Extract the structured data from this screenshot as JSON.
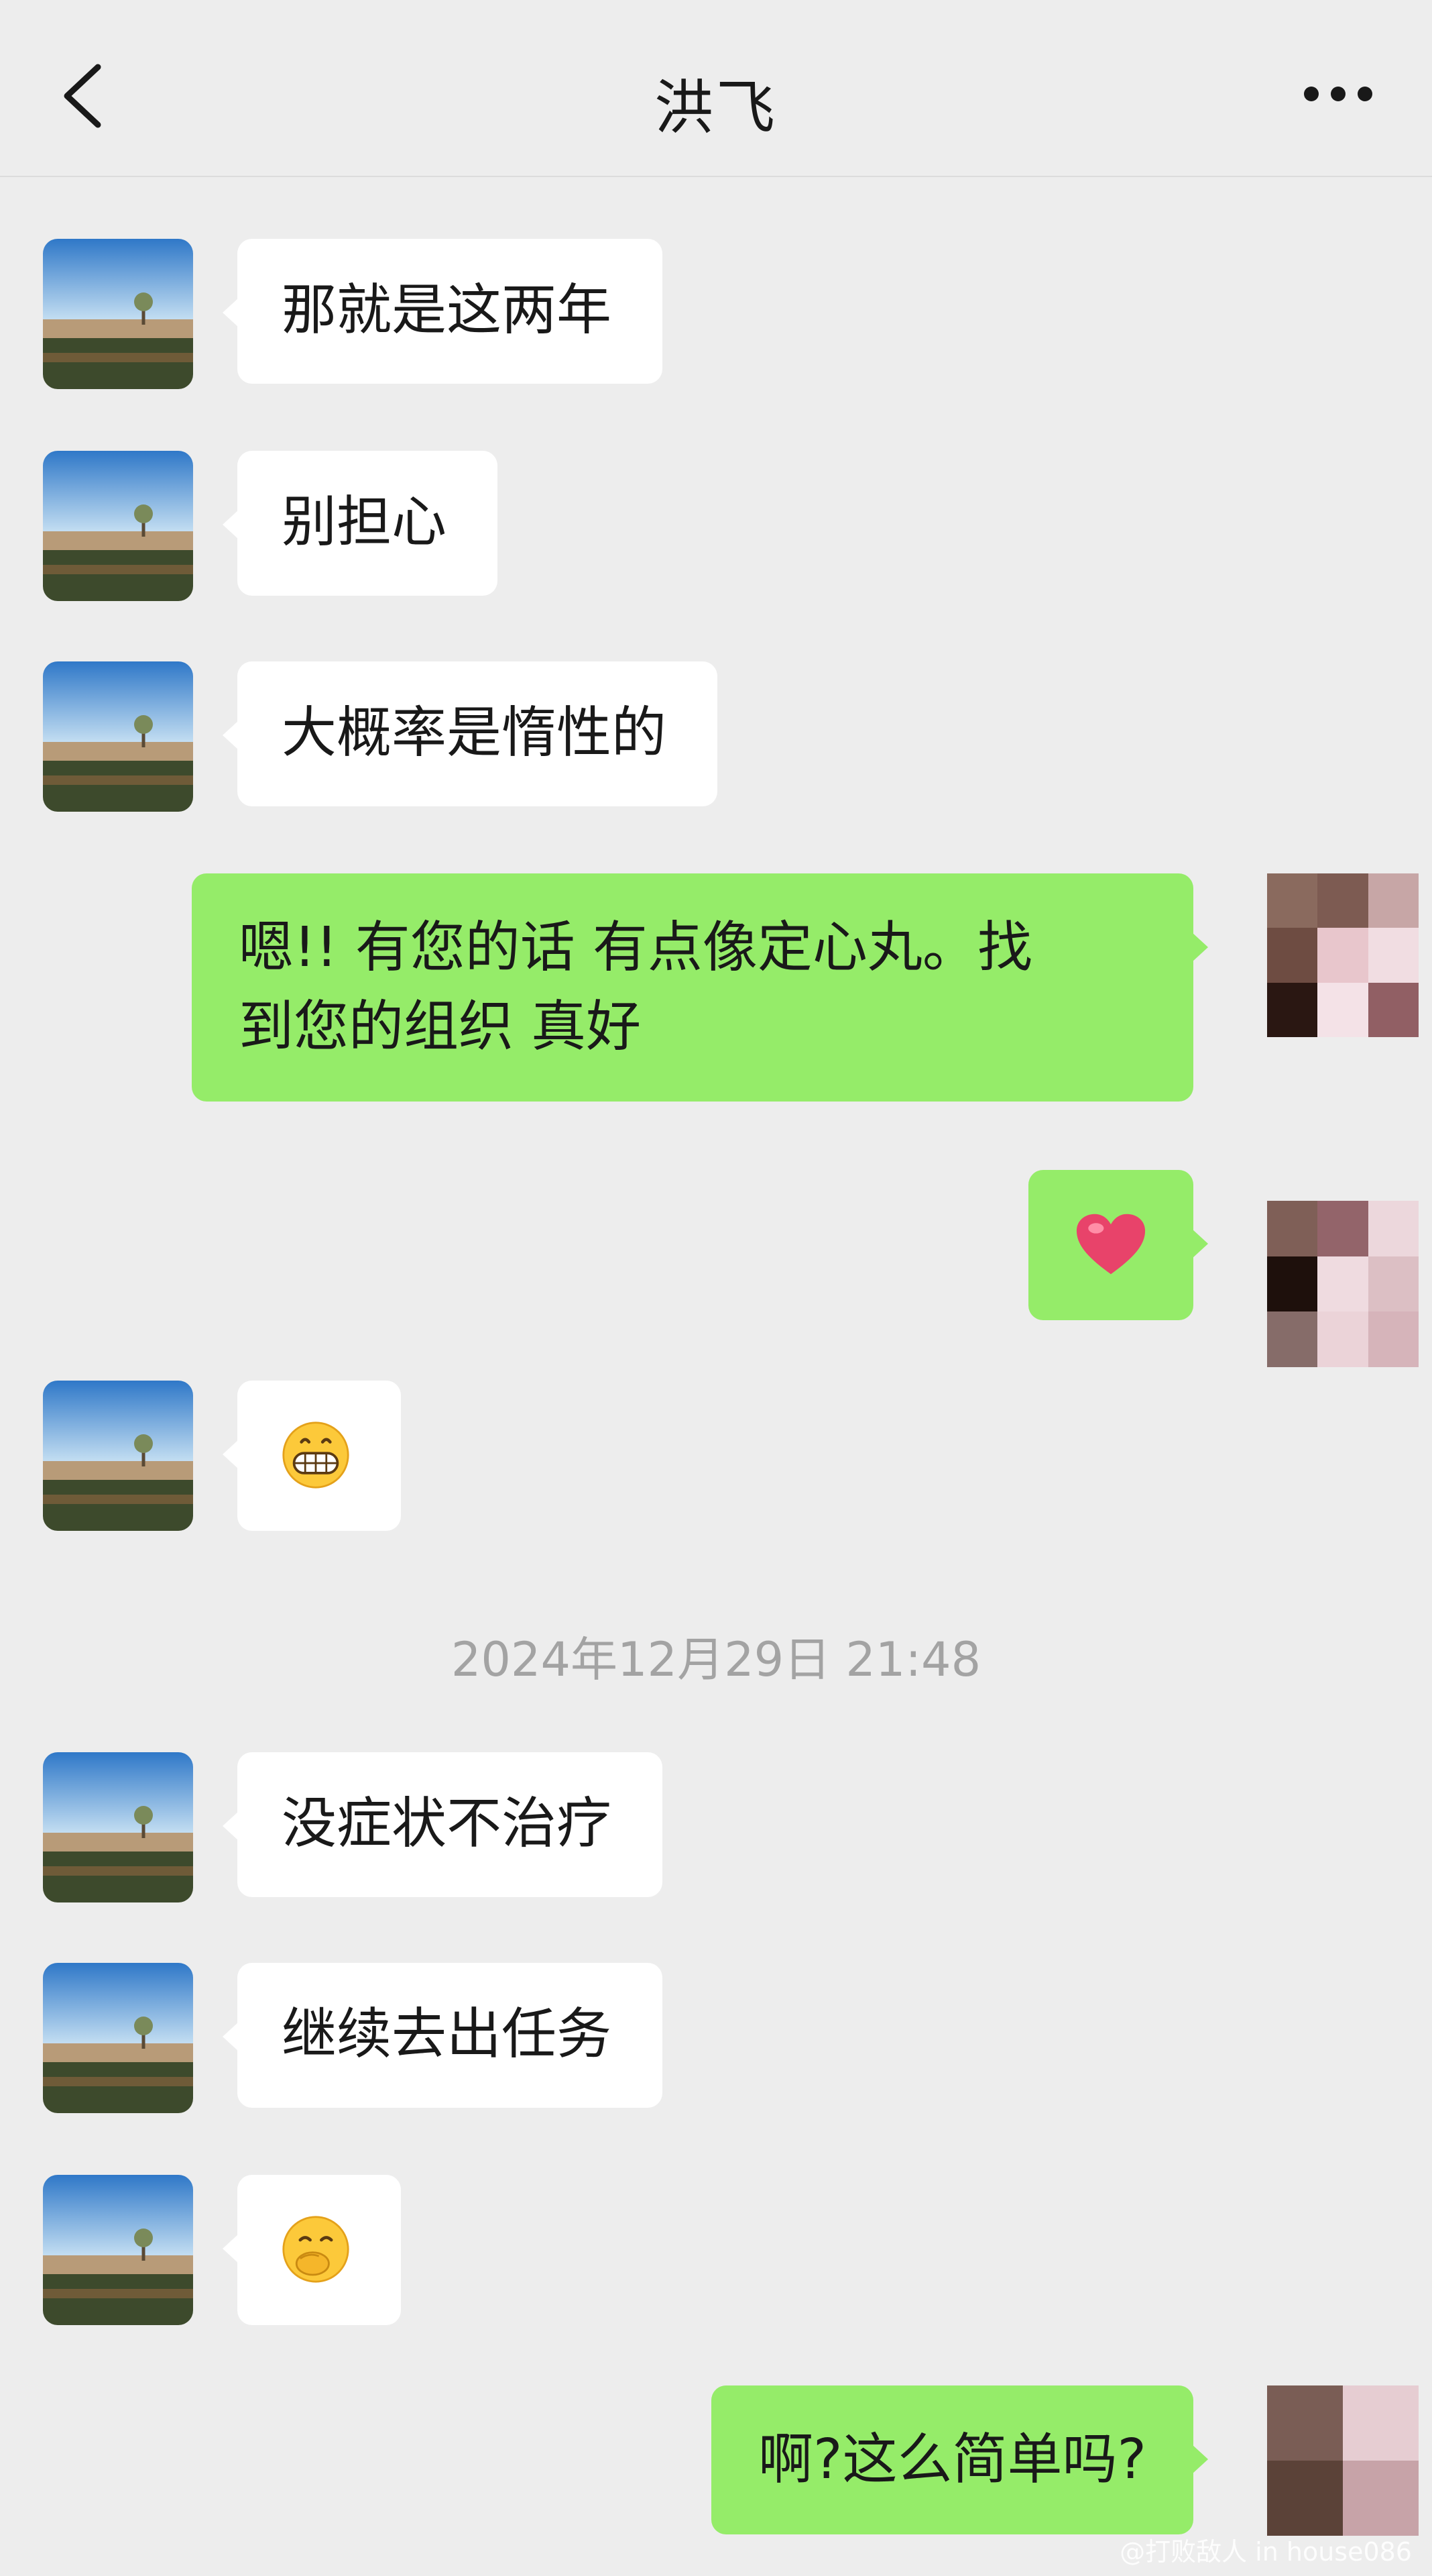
{
  "header": {
    "title": "洪飞"
  },
  "timestamp": "2024年12月29日 21:48",
  "messages": [
    {
      "side": "left",
      "text": "那就是这两年"
    },
    {
      "side": "left",
      "text": "别担心"
    },
    {
      "side": "left",
      "text": "大概率是惰性的"
    },
    {
      "side": "right",
      "line1": "嗯!! 有您的话 有点像定心丸。找",
      "line2": "到您的组织 真好"
    },
    {
      "side": "right",
      "emoji": "heart"
    },
    {
      "side": "left",
      "emoji": "grinning-face"
    },
    {
      "side": "left",
      "text": "没症状不治疗"
    },
    {
      "side": "left",
      "text": "继续去出任务"
    },
    {
      "side": "left",
      "emoji": "hand-over-mouth-face"
    },
    {
      "side": "right",
      "text": "啊?这么简单吗?"
    }
  ],
  "watermark": "@打败敌人 in house086",
  "colors": {
    "background": "#ededed",
    "incoming": "#ffffff",
    "outgoing": "#95ec69",
    "timestamp": "#a3a3a3"
  }
}
